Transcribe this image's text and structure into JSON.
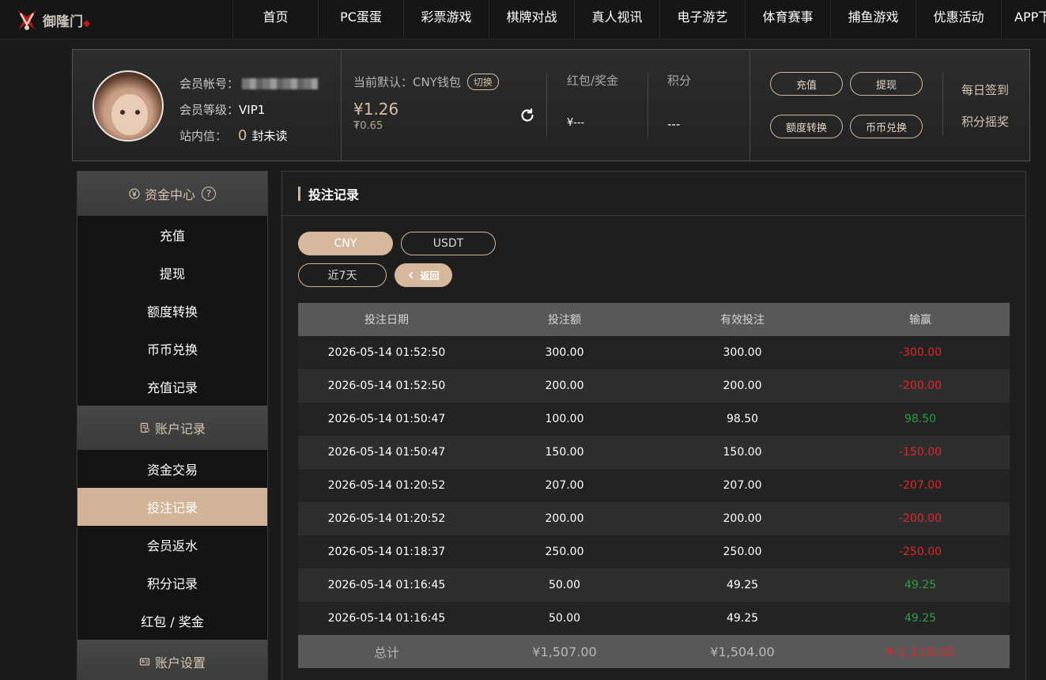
{
  "logo": {
    "text": "御隆门",
    "badge": "◆"
  },
  "nav": [
    "首页",
    "PC蛋蛋",
    "彩票游戏",
    "棋牌对战",
    "真人视讯",
    "电子游艺",
    "体育赛事",
    "捕鱼游戏",
    "优惠活动",
    "APP下载"
  ],
  "member": {
    "account_label": "会员帐号：",
    "level_label": "会员等级：",
    "level_value": "VIP1",
    "inbox_label": "站内信：",
    "unread_count": "0",
    "unread_suffix": "封未读"
  },
  "wallet": {
    "label": "当前默认：CNY钱包",
    "switch": "切换",
    "amount": "¥1.26",
    "sub_amount": "₮0.65"
  },
  "stats": {
    "redpacket_label": "红包/奖金",
    "redpacket_value": "¥---",
    "points_label": "积分",
    "points_value": "---"
  },
  "actions": {
    "recharge": "充值",
    "withdraw": "提现",
    "transfer": "额度转换",
    "exchange": "币币兑换",
    "daily_signin": "每日签到",
    "points_lottery": "积分摇奖"
  },
  "sidebar": {
    "section1": "资金中心",
    "items1": [
      "充值",
      "提现",
      "额度转换",
      "币币兑换",
      "充值记录"
    ],
    "section2": "账户记录",
    "items2": [
      "资金交易",
      "投注记录",
      "会员返水",
      "积分记录",
      "红包 / 奖金"
    ],
    "section3": "账户设置",
    "active": "投注记录"
  },
  "main": {
    "title": "投注记录",
    "currency_cny": "CNY",
    "currency_usdt": "USDT",
    "range": "近7天",
    "back": "返回"
  },
  "table": {
    "headers": [
      "投注日期",
      "投注额",
      "有效投注",
      "输赢"
    ],
    "rows": [
      {
        "date": "2026-05-14 01:52:50",
        "bet": "300.00",
        "valid": "300.00",
        "win": "-300.00",
        "sign": "neg"
      },
      {
        "date": "2026-05-14 01:52:50",
        "bet": "200.00",
        "valid": "200.00",
        "win": "-200.00",
        "sign": "neg"
      },
      {
        "date": "2026-05-14 01:50:47",
        "bet": "100.00",
        "valid": "98.50",
        "win": "98.50",
        "sign": "pos"
      },
      {
        "date": "2026-05-14 01:50:47",
        "bet": "150.00",
        "valid": "150.00",
        "win": "-150.00",
        "sign": "neg"
      },
      {
        "date": "2026-05-14 01:20:52",
        "bet": "207.00",
        "valid": "207.00",
        "win": "-207.00",
        "sign": "neg"
      },
      {
        "date": "2026-05-14 01:20:52",
        "bet": "200.00",
        "valid": "200.00",
        "win": "-200.00",
        "sign": "neg"
      },
      {
        "date": "2026-05-14 01:18:37",
        "bet": "250.00",
        "valid": "250.00",
        "win": "-250.00",
        "sign": "neg"
      },
      {
        "date": "2026-05-14 01:16:45",
        "bet": "50.00",
        "valid": "49.25",
        "win": "49.25",
        "sign": "pos"
      },
      {
        "date": "2026-05-14 01:16:45",
        "bet": "50.00",
        "valid": "49.25",
        "win": "49.25",
        "sign": "pos"
      }
    ],
    "total": {
      "label": "总计",
      "bet": "¥1,507.00",
      "valid": "¥1,504.00",
      "win": "¥-1,110.00"
    }
  },
  "colors": {
    "accent": "#d2b599",
    "negative": "#e0262b",
    "positive": "#2ea043"
  }
}
